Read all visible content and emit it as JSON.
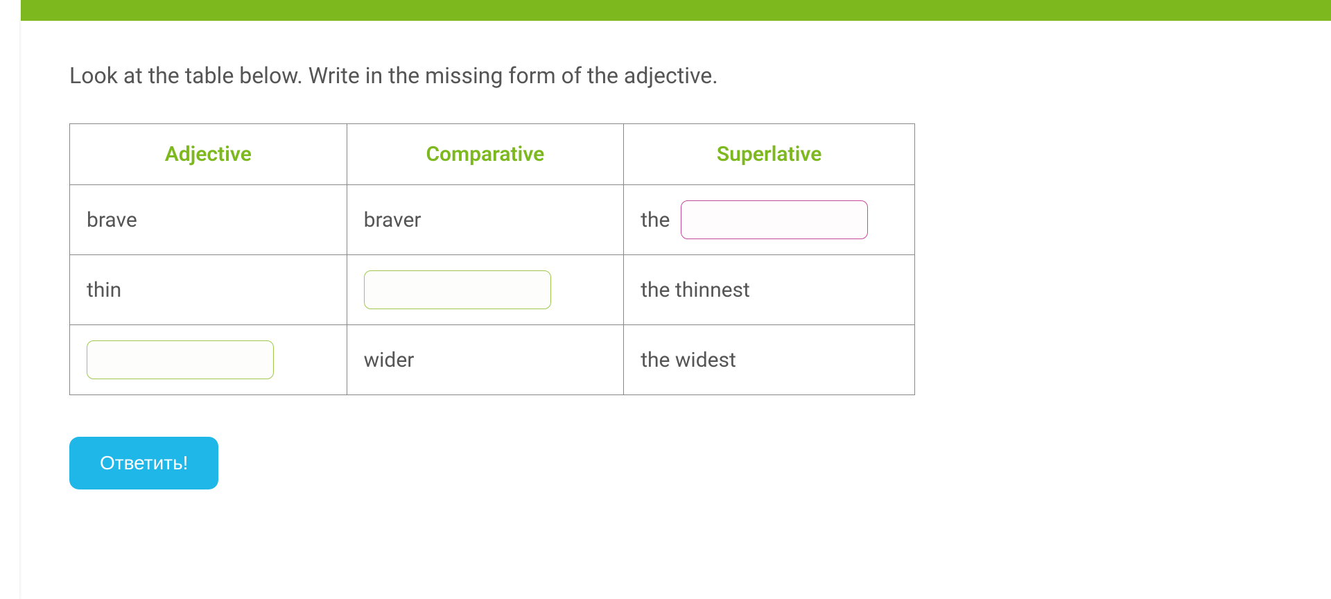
{
  "instruction": "Look at the table below. Write in the missing form of the adjective.",
  "table": {
    "headers": {
      "adjective": "Adjective",
      "comparative": "Comparative",
      "superlative": "Superlative"
    },
    "rows": [
      {
        "adjective": "brave",
        "comparative": "braver",
        "superlative_prefix": "the",
        "superlative_input": ""
      },
      {
        "adjective": "thin",
        "comparative_input": "",
        "superlative": "the thinnest"
      },
      {
        "adjective_input": "",
        "comparative": "wider",
        "superlative": "the widest"
      }
    ]
  },
  "button": {
    "answer": "Ответить!"
  }
}
